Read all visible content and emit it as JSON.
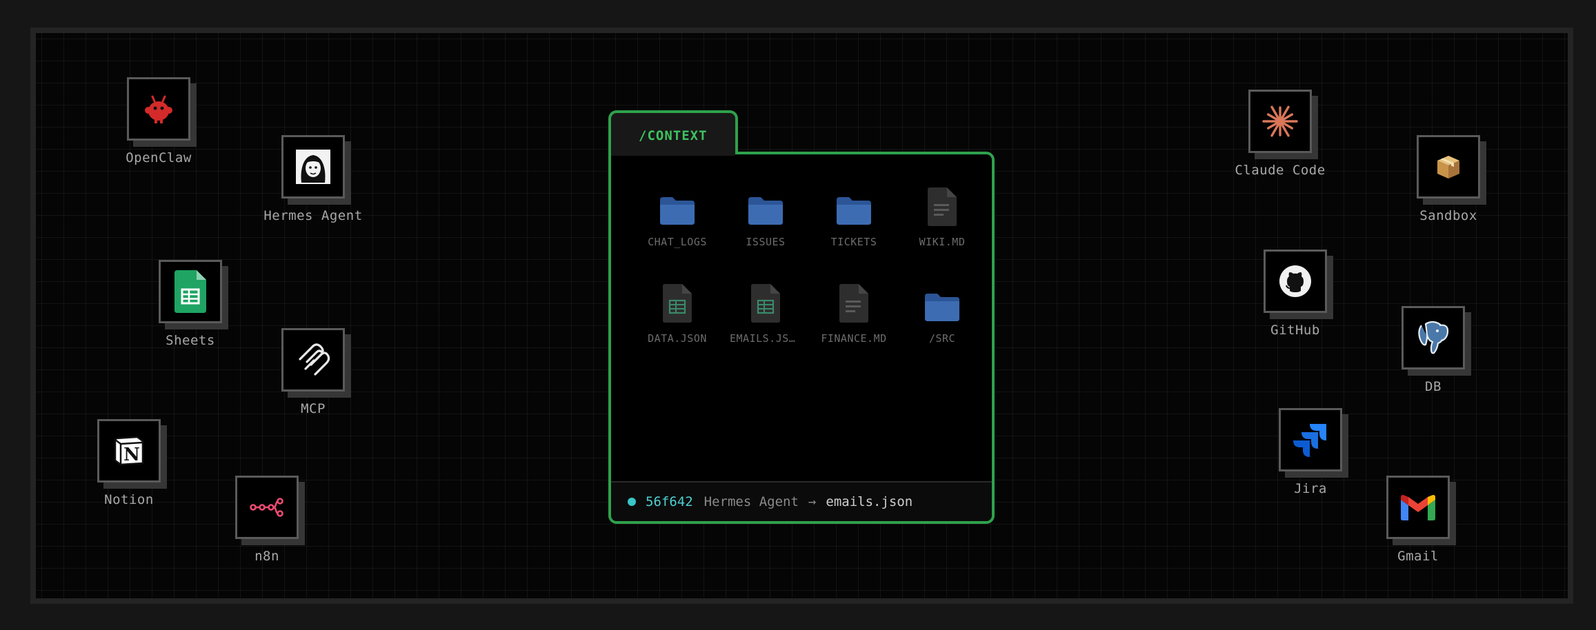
{
  "tools_left": [
    {
      "id": "openclaw",
      "label": "OpenClaw",
      "icon": "red-claw-mascot-icon"
    },
    {
      "id": "hermes",
      "label": "Hermes Agent",
      "icon": "hermes-portrait-icon"
    },
    {
      "id": "sheets",
      "label": "Sheets",
      "icon": "google-sheets-icon"
    },
    {
      "id": "mcp",
      "label": "MCP",
      "icon": "mcp-icon"
    },
    {
      "id": "notion",
      "label": "Notion",
      "icon": "notion-icon"
    },
    {
      "id": "n8n",
      "label": "n8n",
      "icon": "n8n-icon"
    }
  ],
  "tools_right": [
    {
      "id": "claude",
      "label": "Claude Code",
      "icon": "claude-sunburst-icon"
    },
    {
      "id": "sandbox",
      "label": "Sandbox",
      "icon": "package-box-icon"
    },
    {
      "id": "github",
      "label": "GitHub",
      "icon": "github-icon"
    },
    {
      "id": "db",
      "label": "DB",
      "icon": "postgres-elephant-icon"
    },
    {
      "id": "jira",
      "label": "Jira",
      "icon": "jira-icon"
    },
    {
      "id": "gmail",
      "label": "Gmail",
      "icon": "gmail-icon"
    }
  ],
  "context": {
    "tab_label": "/CONTEXT",
    "items": [
      {
        "name": "CHAT_LOGS",
        "kind": "folder"
      },
      {
        "name": "ISSUES",
        "kind": "folder"
      },
      {
        "name": "TICKETS",
        "kind": "folder"
      },
      {
        "name": "WIKI.MD",
        "kind": "doc"
      },
      {
        "name": "DATA.JSON",
        "kind": "sheet"
      },
      {
        "name": "EMAILS.JSON",
        "kind": "sheet"
      },
      {
        "name": "FINANCE.MD",
        "kind": "doc"
      },
      {
        "name": "/SRC",
        "kind": "folder"
      }
    ],
    "status": {
      "hash": "56f642",
      "agent": "Hermes Agent",
      "arrow": "→",
      "file": "emails.json"
    }
  },
  "colors": {
    "accent_green": "#2fa14c",
    "status_dot": "#39c6c8",
    "folder_blue": "#3d6cb3"
  }
}
